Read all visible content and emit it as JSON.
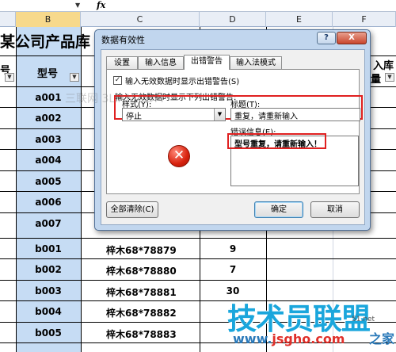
{
  "formula_bar": {
    "fx_label": "fx"
  },
  "columns": [
    {
      "letter": "B",
      "selected": true
    },
    {
      "letter": "C"
    },
    {
      "letter": "D"
    },
    {
      "letter": "E"
    },
    {
      "letter": "F"
    }
  ],
  "sheet": {
    "title_fragment": "某公司产品库",
    "header_left_fragment": "号",
    "header_model": "型号",
    "header_right_line1": "入库",
    "header_right_line2": "量",
    "rows": [
      {
        "model": "a001",
        "name": "",
        "qty": ""
      },
      {
        "model": "a002",
        "name": "",
        "qty": ""
      },
      {
        "model": "a003",
        "name": "",
        "qty": ""
      },
      {
        "model": "a004",
        "name": "",
        "qty": ""
      },
      {
        "model": "a005",
        "name": "",
        "qty": ""
      },
      {
        "model": "a006",
        "name": "",
        "qty": ""
      },
      {
        "model": "a007",
        "name": "",
        "qty": ""
      },
      {
        "model": "b001",
        "name": "梓木68*78879",
        "qty": "9"
      },
      {
        "model": "b002",
        "name": "梓木68*78880",
        "qty": "7"
      },
      {
        "model": "b003",
        "name": "梓木68*78881",
        "qty": "30"
      },
      {
        "model": "b004",
        "name": "梓木68*78882",
        "qty": "6"
      },
      {
        "model": "b005",
        "name": "梓木68*78883",
        "qty": ""
      }
    ]
  },
  "dialog": {
    "title": "数据有效性",
    "help_label": "?",
    "close_label": "X",
    "tabs": [
      {
        "label": "设置"
      },
      {
        "label": "输入信息"
      },
      {
        "label": "出错警告",
        "active": true
      },
      {
        "label": "输入法模式"
      }
    ],
    "show_alert_label": "输入无效数据时显示出错警告(S)",
    "show_alert_checked": true,
    "section_label": "输入无效数据时显示下列出错警告:",
    "style_label": "样式(Y):",
    "style_value": "停止",
    "title_field_label": "标题(T):",
    "title_value": "重复，请重新输入",
    "error_msg_label": "错误信息(E):",
    "error_msg_value": "型号重复，请重新输入！",
    "clear_all_button": "全部清除(C)",
    "ok_button": "确定",
    "cancel_button": "取消",
    "accent_color": "#e02020"
  },
  "watermarks": {
    "faint": "三联网 3LIAN.COM",
    "brand": "技术员联盟",
    "small": "51.net",
    "url_prefix": "www.",
    "url_main": "jsgho.com",
    "url_suffix": "之家"
  }
}
